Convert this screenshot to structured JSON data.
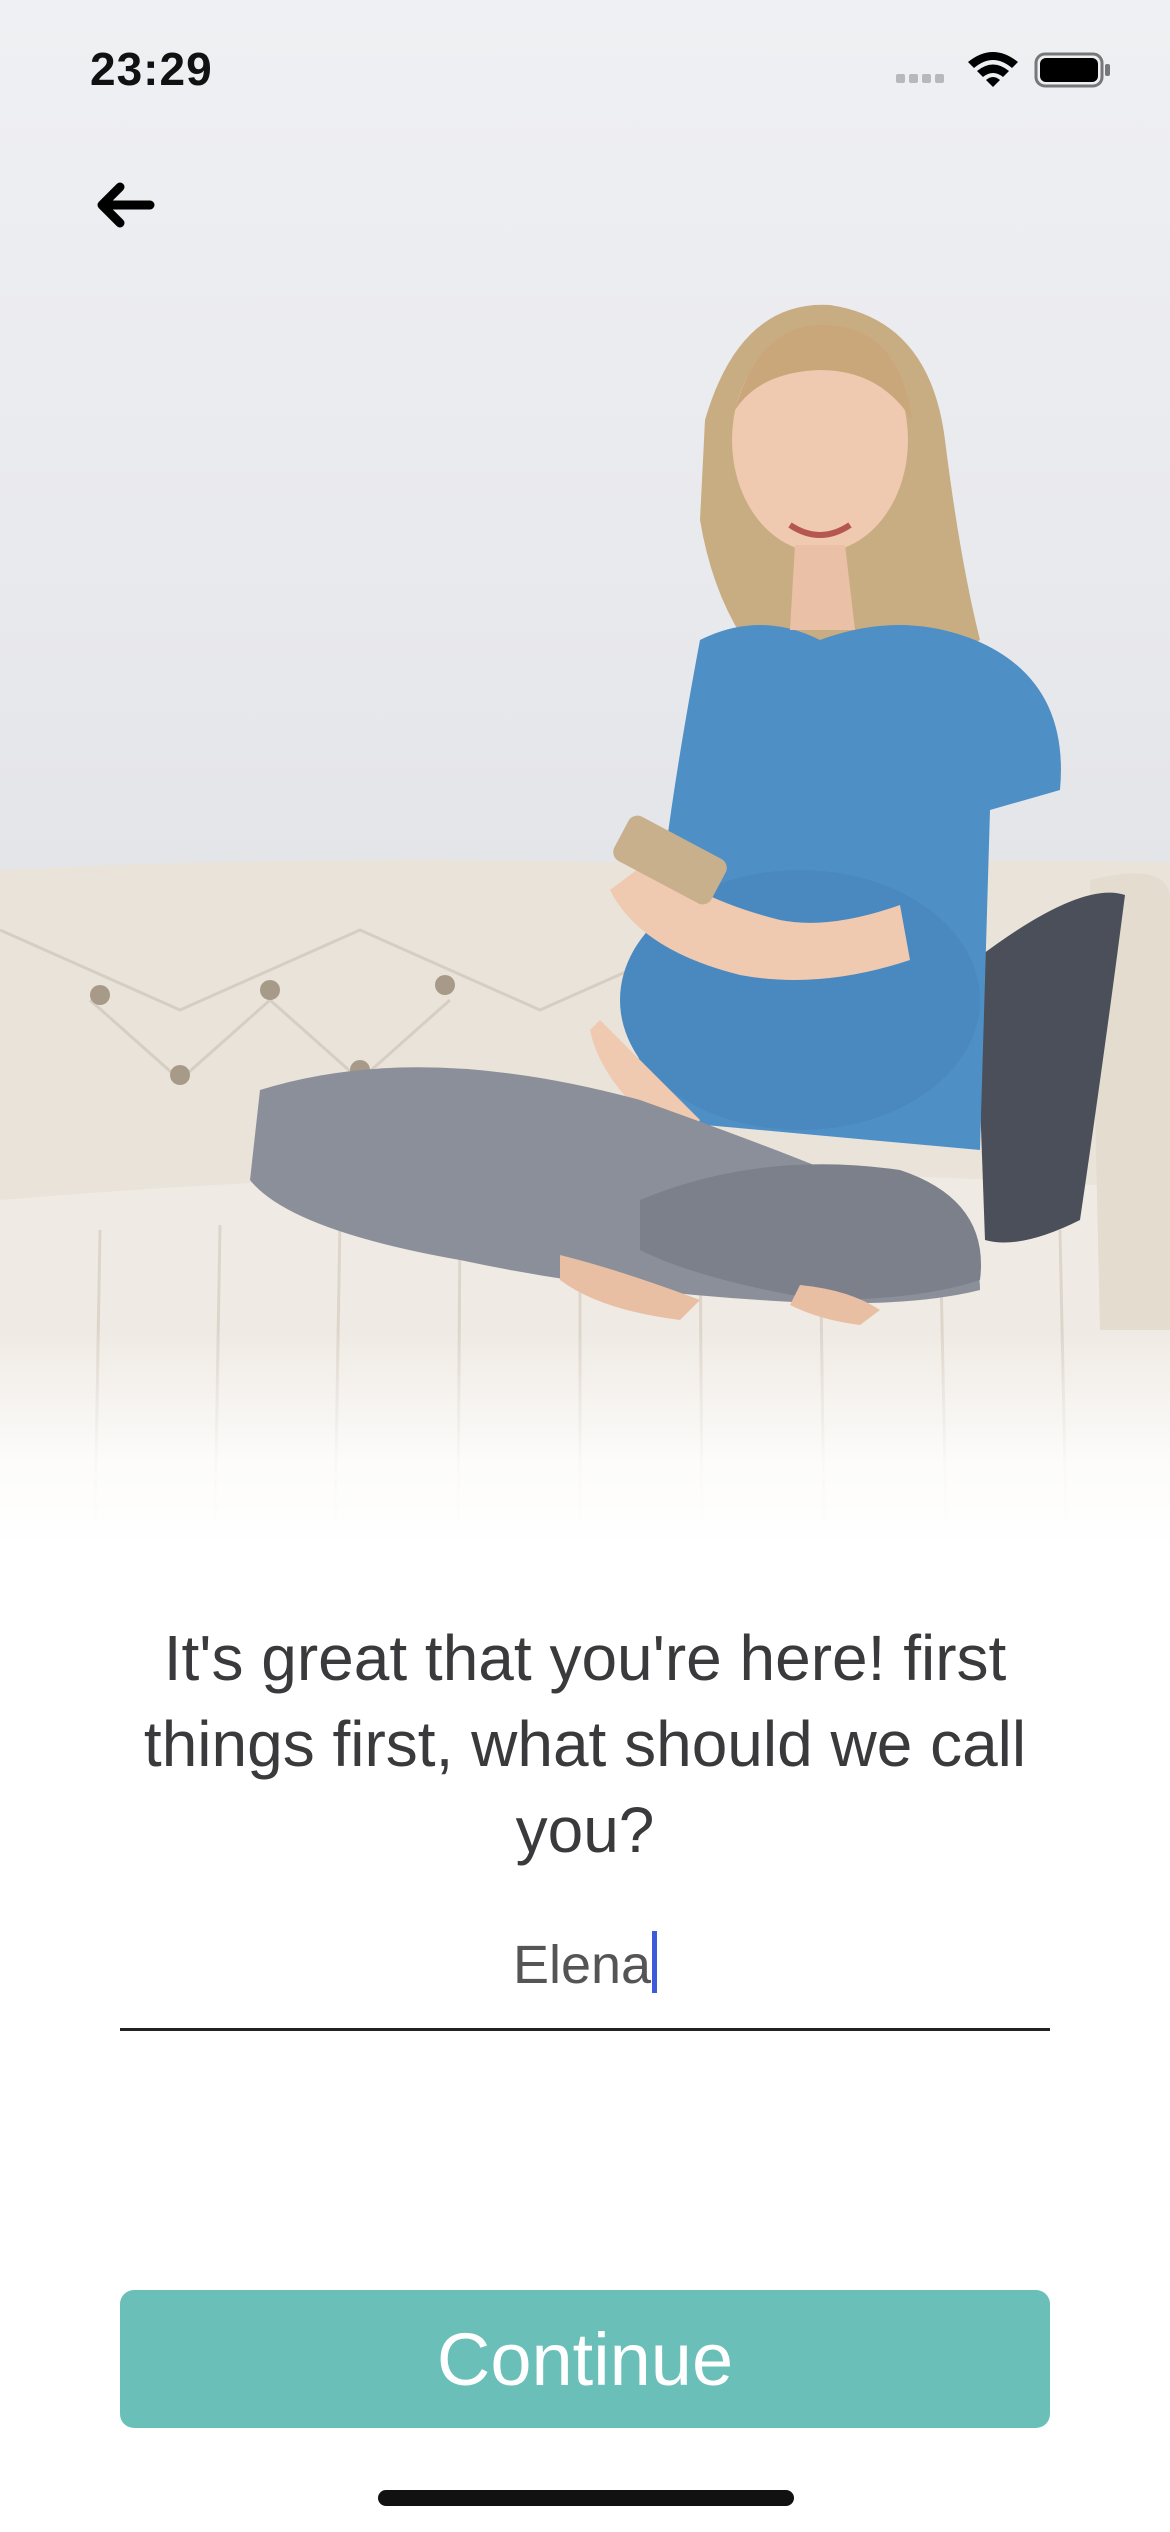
{
  "status_bar": {
    "time": "23:29"
  },
  "icons": {
    "back": "arrow-left-icon",
    "wifi": "wifi-icon",
    "battery": "battery-icon",
    "signal": "cellular-signal-icon"
  },
  "onboarding": {
    "headline": "It's great that you're here! first things first, what should we call you?",
    "name_value": "Elena",
    "continue_label": "Continue"
  },
  "colors": {
    "accent": "#6ac0b8",
    "caret": "#3b5bdb",
    "text": "#3a3a3c"
  }
}
